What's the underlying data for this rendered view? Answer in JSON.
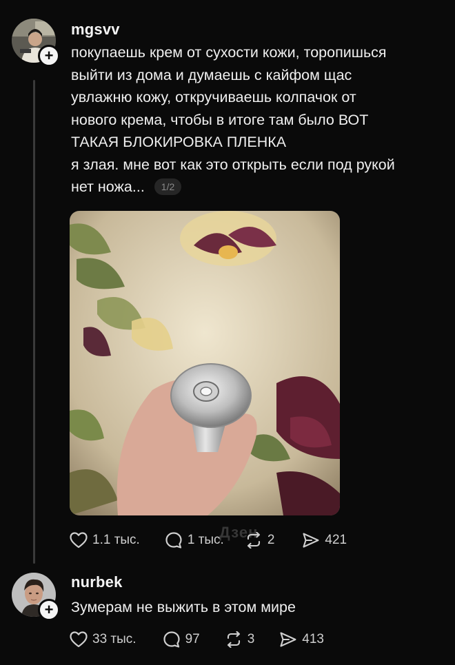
{
  "post1": {
    "username": "mgsvv",
    "text_lines": [
      "покупаешь крем от сухости кожи, торопишься",
      "выйти из дома и думаешь с кайфом щас",
      "увлажню кожу, откручиваешь колпачок от",
      "нового крема, чтобы в итоге там было ВОТ",
      "ТАКАЯ БЛОКИРОВКА ПЛЕНКА",
      "я злая. мне вот как это открыть если под рукой",
      "нет ножа..."
    ],
    "media_counter": "1/2",
    "likes": "1.1 тыс.",
    "comments": "1 тыс.",
    "reposts": "2",
    "shares": "421",
    "watermark": "Дзен"
  },
  "post2": {
    "username": "nurbek",
    "text": "Зумерам не выжить в этом мире",
    "likes": "33 тыс.",
    "comments": "97",
    "reposts": "3",
    "shares": "413"
  },
  "icons": {
    "like": "heart-icon",
    "comment": "comment-bubble-icon",
    "repost": "repost-arrows-icon",
    "share": "send-icon",
    "follow": "plus-icon"
  },
  "colors": {
    "background": "#0a0a0a",
    "text": "#f3f3f3",
    "secondary": "#cfcfcf",
    "thread_line": "#3a3a3a"
  }
}
